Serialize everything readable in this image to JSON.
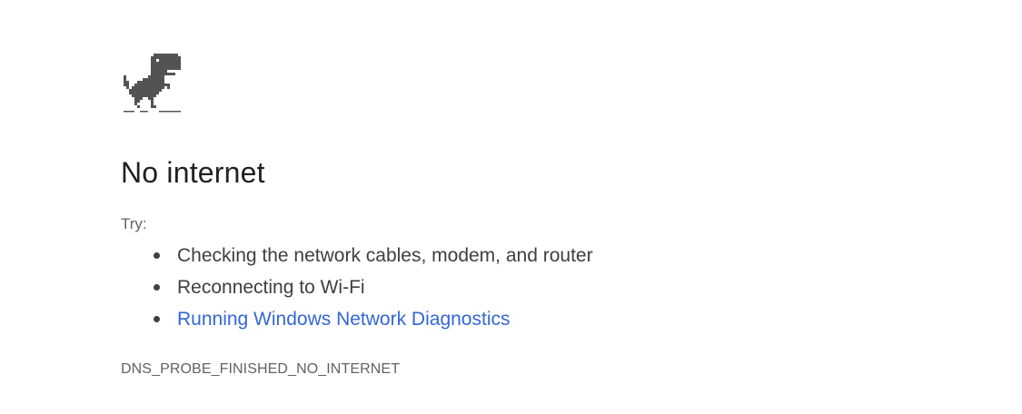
{
  "page": {
    "title": "No internet",
    "try_label": "Try:",
    "suggestions": [
      {
        "text": "Checking the network cables, modem, and router",
        "link": false
      },
      {
        "text": "Reconnecting to Wi-Fi",
        "link": false
      },
      {
        "text": "Running Windows Network Diagnostics",
        "link": true
      }
    ],
    "error_code": "DNS_PROBE_FINISHED_NO_INTERNET"
  },
  "icons": {
    "offline": "dinosaur-icon"
  },
  "colors": {
    "text": "#202124",
    "secondary_text": "#5f6368",
    "link": "#3367d6",
    "dino": "#535353"
  }
}
